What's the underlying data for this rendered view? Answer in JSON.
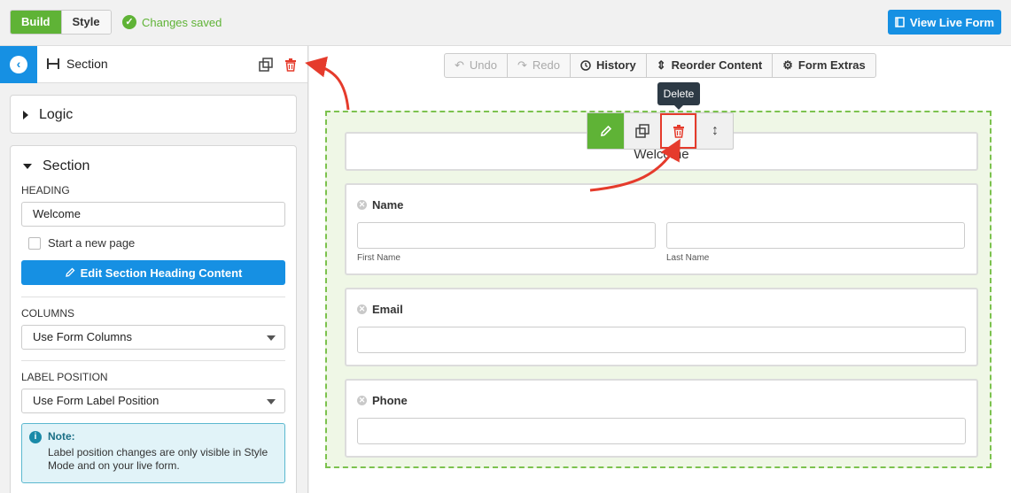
{
  "topbar": {
    "mode_build": "Build",
    "mode_style": "Style",
    "saved_text": "Changes saved",
    "view_live_label": "View Live Form"
  },
  "sidebar": {
    "title": "Section",
    "logic_label": "Logic",
    "section_label": "Section",
    "heading_label": "HEADING",
    "heading_value": "Welcome",
    "new_page_label": "Start a new page",
    "edit_heading_label": "Edit Section Heading Content",
    "columns_label": "COLUMNS",
    "columns_value": "Use Form Columns",
    "label_position_label": "LABEL POSITION",
    "label_position_value": "Use Form Label Position",
    "note_title": "Note:",
    "note_body": "Label position changes are only visible in Style Mode and on your live form."
  },
  "toolbar": {
    "undo": "Undo",
    "redo": "Redo",
    "history": "History",
    "reorder": "Reorder Content",
    "extras": "Form Extras"
  },
  "form": {
    "welcome": "Welcome",
    "tooltip": "Delete",
    "fields": {
      "name": {
        "label": "Name",
        "first": "First Name",
        "last": "Last Name"
      },
      "email": {
        "label": "Email"
      },
      "phone": {
        "label": "Phone"
      }
    }
  },
  "colors": {
    "green": "#5fb336",
    "blue": "#1690e3",
    "red": "#e53b2c",
    "dashed_border": "#7cc24e"
  }
}
